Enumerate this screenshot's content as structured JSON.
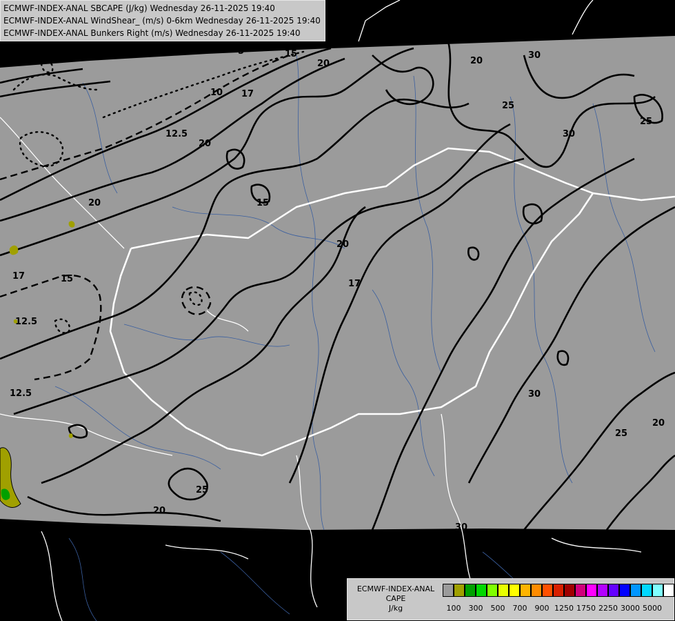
{
  "header": {
    "line1": "ECMWF-INDEX-ANAL SBCAPE (J/kg) Wednesday 26-11-2025 19:40",
    "line2": "ECMWF-INDEX-ANAL WindShear_ (m/s) 0-6km Wednesday 26-11-2025 19:40",
    "line3": "ECMWF-INDEX-ANAL Bunkers Right (m/s) Wednesday 26-11-2025 19:40"
  },
  "legend": {
    "title1": "ECMWF-INDEX-ANAL",
    "title2": "CAPE",
    "units": "J/kg",
    "tick_labels": [
      "100",
      "300",
      "500",
      "700",
      "900",
      "1250",
      "1750",
      "2250",
      "3000",
      "5000"
    ],
    "colors": [
      "#9b9b9b",
      "#a0a000",
      "#00a000",
      "#00d800",
      "#80ff00",
      "#e8ff00",
      "#ffff00",
      "#ffb400",
      "#ff8c00",
      "#ff5000",
      "#d82000",
      "#a00000",
      "#d0007c",
      "#ff00ff",
      "#b400ff",
      "#6400ff",
      "#0000ff",
      "#0096ff",
      "#00d8ff",
      "#80ffff",
      "#ffffff"
    ]
  },
  "contour_labels": [
    "5",
    "5",
    "15",
    "20",
    "20",
    "30",
    "25",
    "25",
    "30",
    "10",
    "17",
    "12.5",
    "20",
    "15",
    "20",
    "20",
    "17",
    "17",
    "15",
    "12.5",
    "12.5",
    "30",
    "20",
    "25",
    "25",
    "20",
    "30"
  ],
  "colors": {
    "map_fill": "#9b9b9b",
    "outside": "#000000",
    "border": "#ffffff",
    "rivers": "#3a5fa0",
    "contours": "#000000"
  }
}
